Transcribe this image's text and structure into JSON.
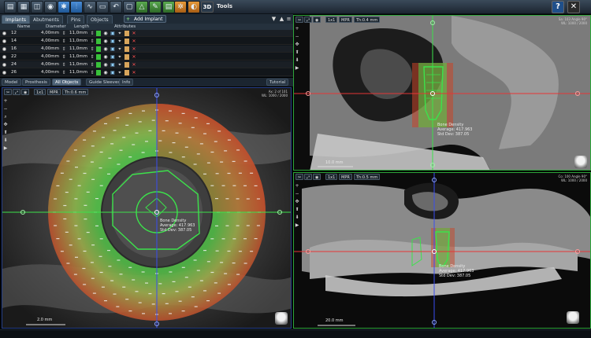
{
  "app": {
    "title": "Tools",
    "three_d_label": "3D",
    "help_label": "?",
    "close_label": "✕"
  },
  "toolbar": {
    "buttons": [
      {
        "name": "open-icon",
        "glyph": "▤"
      },
      {
        "name": "save-icon",
        "glyph": "▦"
      },
      {
        "name": "layers-icon",
        "glyph": "◫"
      },
      {
        "name": "camera-icon",
        "glyph": "◉"
      },
      {
        "name": "tools-icon",
        "glyph": "✱"
      },
      {
        "name": "implant-icon",
        "glyph": "⫶"
      },
      {
        "name": "nerve-icon",
        "glyph": "∿"
      },
      {
        "name": "sleeve-icon",
        "glyph": "▭"
      },
      {
        "name": "undo-icon",
        "glyph": "↶"
      },
      {
        "name": "model-icon",
        "glyph": "▢"
      },
      {
        "name": "measure-icon",
        "glyph": "△"
      },
      {
        "name": "annotate-icon",
        "glyph": "✎"
      },
      {
        "name": "report-icon",
        "glyph": "▤"
      },
      {
        "name": "export-icon",
        "glyph": "▣"
      },
      {
        "name": "bone-density-icon",
        "glyph": "✲"
      },
      {
        "name": "contrast-icon",
        "glyph": "◐"
      }
    ]
  },
  "tabs": [
    {
      "label": "Implants",
      "active": true
    },
    {
      "label": "Abutments",
      "active": false
    },
    {
      "label": "Pins",
      "active": false
    },
    {
      "label": "Objects",
      "active": false
    }
  ],
  "add_implant": {
    "label": "Add Implant"
  },
  "implant_table": {
    "headers": {
      "name": "Name",
      "diameter": "Diameter",
      "length": "Length",
      "attributes": "Attributes"
    },
    "rows": [
      {
        "name": "12",
        "diameter": "4,00mm",
        "length": "11,0mm"
      },
      {
        "name": "14",
        "diameter": "4,00mm",
        "length": "11,0mm"
      },
      {
        "name": "16",
        "diameter": "4,00mm",
        "length": "11,0mm"
      },
      {
        "name": "22",
        "diameter": "4,00mm",
        "length": "11,0mm"
      },
      {
        "name": "24",
        "diameter": "4,00mm",
        "length": "11,0mm"
      },
      {
        "name": "26",
        "diameter": "4,00mm",
        "length": "11,0mm"
      }
    ]
  },
  "subtabs": [
    {
      "label": "Model",
      "active": false
    },
    {
      "label": "Prosthesis",
      "active": false
    },
    {
      "label": "All Objects",
      "active": true
    },
    {
      "label": "Guide Sleeves",
      "active": false
    },
    {
      "label": "Info",
      "active": false
    }
  ],
  "tutorial_label": "Tutorial",
  "viewports": {
    "left": {
      "ctl_1": "1x1",
      "ctl_2": "MPR",
      "ctl_3": "Th:0.6 mm",
      "info": "Ax: 2 of 101\nWL: 1000 / 2000",
      "annotation_title": "Bone Density",
      "annotation_avg": "Average: 417.963",
      "annotation_std": "Std Dev: 387.05",
      "scale": "2.0 mm"
    },
    "top": {
      "ctl_1": "1x1",
      "ctl_2": "MPR",
      "ctl_3": "Th:0.4 mm",
      "info": "Sa: 103 Angle 90°\nWL: 1000 / 2000",
      "annotation_title": "Bone Density",
      "annotation_avg": "Average: 417.963",
      "annotation_std": "Std Dev: 387.05",
      "scale": "10.0 mm"
    },
    "bottom": {
      "ctl_1": "1x1",
      "ctl_2": "MPR",
      "ctl_3": "Th:0.5 mm",
      "info": "Co: 100 Angle 90°\nWL: 1000 / 2000",
      "annotation_title": "Bone Density",
      "annotation_avg": "Average: 417.963",
      "annotation_std": "Std Dev: 387.05",
      "scale": "20.0 mm"
    }
  },
  "colors": {
    "accent_blue": "#3b82e0",
    "crosshair_green": "#3ce24b",
    "crosshair_red": "#e53535",
    "crosshair_blue": "#3a4ef0",
    "bone_green": "#4cd24a",
    "bone_red": "#c84628"
  }
}
